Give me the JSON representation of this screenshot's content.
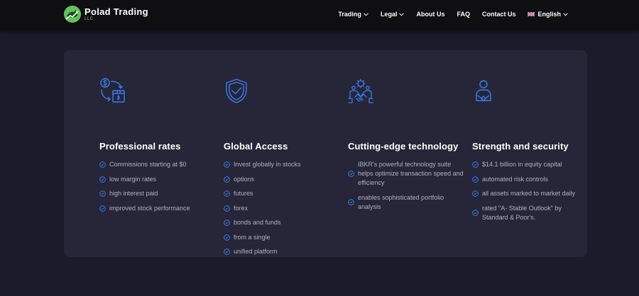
{
  "brand": {
    "name": "Polad Trading",
    "sub": "LLC"
  },
  "nav": {
    "items": [
      {
        "label": "Trading",
        "has_dropdown": true
      },
      {
        "label": "Legal",
        "has_dropdown": true
      },
      {
        "label": "About Us",
        "has_dropdown": false
      },
      {
        "label": "FAQ",
        "has_dropdown": false
      },
      {
        "label": "Contact Us",
        "has_dropdown": false
      }
    ],
    "language": {
      "label": "English",
      "icon": "uk-flag-icon"
    }
  },
  "colors": {
    "background": "#1c1b2b",
    "navbar": "#0f0f12",
    "card": "#262638",
    "accent": "#3b7df0",
    "brand_green": "#62c15a",
    "text_muted": "#aeb3c2"
  },
  "features": [
    {
      "icon": "currency-exchange-icon",
      "title": "Professional rates",
      "items": [
        "Commissions starting at $0",
        "low margin rates",
        "high interest paid",
        "improved stock performance"
      ]
    },
    {
      "icon": "shield-check-icon",
      "title": "Global Access",
      "items": [
        "Invest globally in stocks",
        "options",
        "futures",
        "forex",
        "bonds and funds",
        "from a single",
        "unified platform"
      ]
    },
    {
      "icon": "tech-handshake-icon",
      "title": "Cutting-edge technology",
      "items": [
        "IBKR's powerful technology suite helps optimize transaction speed and efficiency",
        "enables sophisticated portfolio analysis"
      ]
    },
    {
      "icon": "secure-user-icon",
      "title": "Strength and security",
      "items": [
        "$14.1 billion in equity capital",
        "automated risk controls",
        "all assets marked to market daily",
        "rated \"A- Stable Outlook\" by Standard & Poor's."
      ]
    }
  ]
}
